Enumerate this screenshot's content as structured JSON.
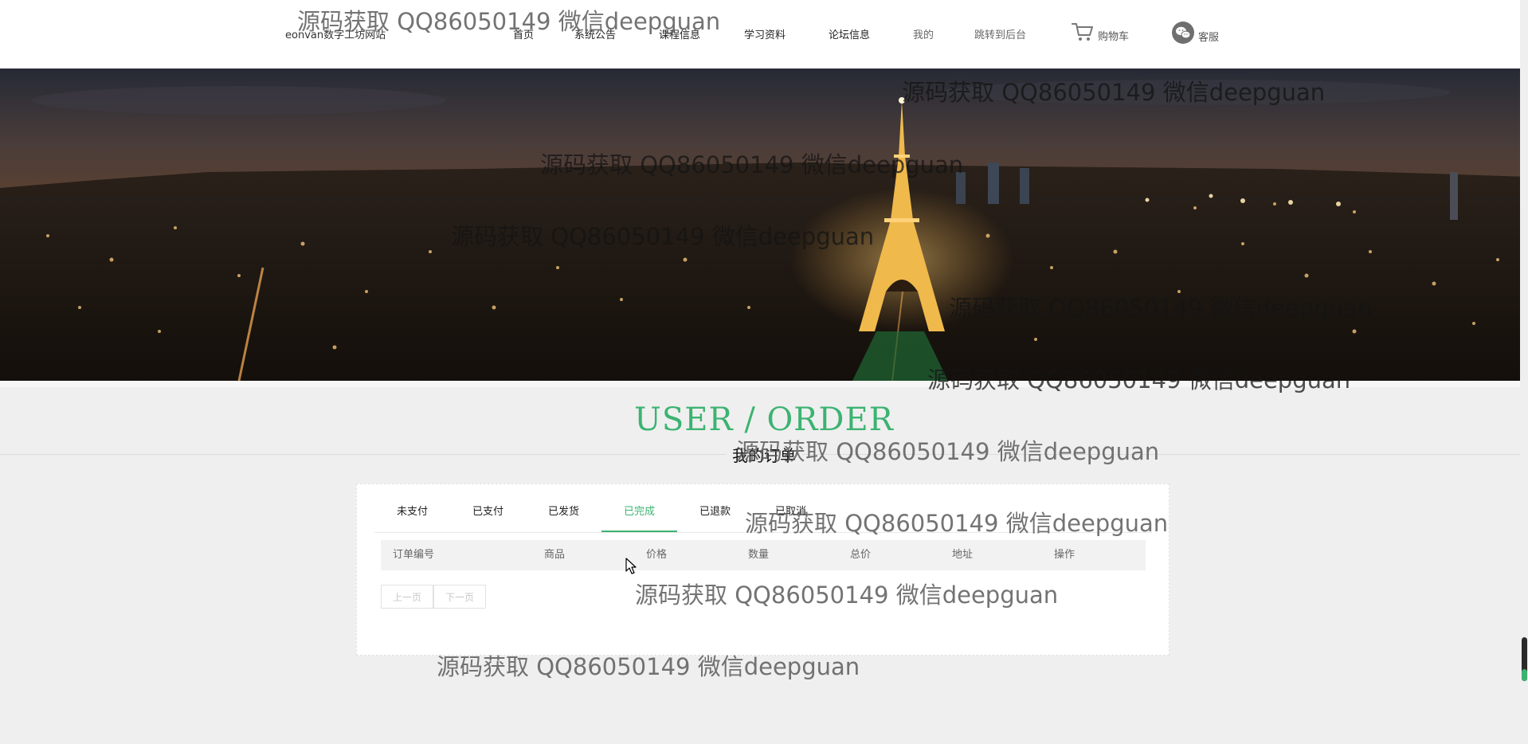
{
  "header": {
    "site_name": "eonvan数字工坊网站",
    "nav": [
      {
        "label": "首页"
      },
      {
        "label": "系统公告"
      },
      {
        "label": "课程信息"
      },
      {
        "label": "学习资料"
      },
      {
        "label": "论坛信息"
      },
      {
        "label": "我的"
      },
      {
        "label": "跳转到后台"
      }
    ],
    "cart_label": "购物车",
    "service_label": "客服"
  },
  "section": {
    "title_en": "USER / ORDER",
    "title_cn": "我的订单"
  },
  "orders": {
    "tabs": [
      {
        "label": "未支付"
      },
      {
        "label": "已支付"
      },
      {
        "label": "已发货"
      },
      {
        "label": "已完成"
      },
      {
        "label": "已退款"
      },
      {
        "label": "已取消"
      }
    ],
    "active_tab": "已完成",
    "columns": [
      "订单编号",
      "商品",
      "价格",
      "数量",
      "总价",
      "地址",
      "操作"
    ],
    "rows": [],
    "prev_label": "上一页",
    "next_label": "下一页"
  },
  "watermark": "源码获取 QQ86050149 微信deepguan",
  "colors": {
    "accent": "#3cb371",
    "page_bg": "#efefef",
    "header_bg": "#ffffff"
  }
}
